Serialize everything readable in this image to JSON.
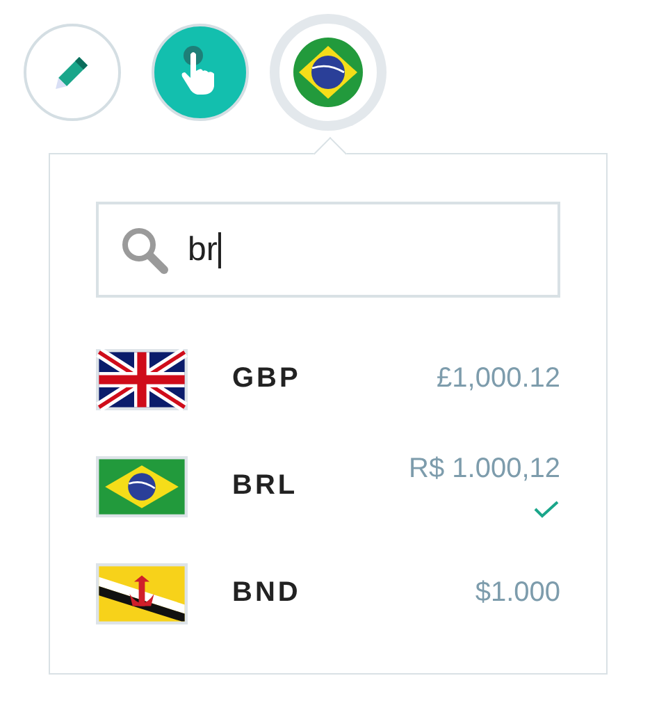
{
  "tools": [
    {
      "kind": "edit",
      "selected": false
    },
    {
      "kind": "pointer",
      "selected": false
    },
    {
      "kind": "flag-br",
      "selected": true
    }
  ],
  "search": {
    "value": "br"
  },
  "currencies": [
    {
      "kind": "uk",
      "code": "GBP",
      "amount": "£1,000.12",
      "selected": false
    },
    {
      "kind": "br",
      "code": "BRL",
      "amount": "R$ 1.000,12",
      "selected": true
    },
    {
      "kind": "bn",
      "code": "BND",
      "amount": "$1.000",
      "selected": false
    }
  ]
}
